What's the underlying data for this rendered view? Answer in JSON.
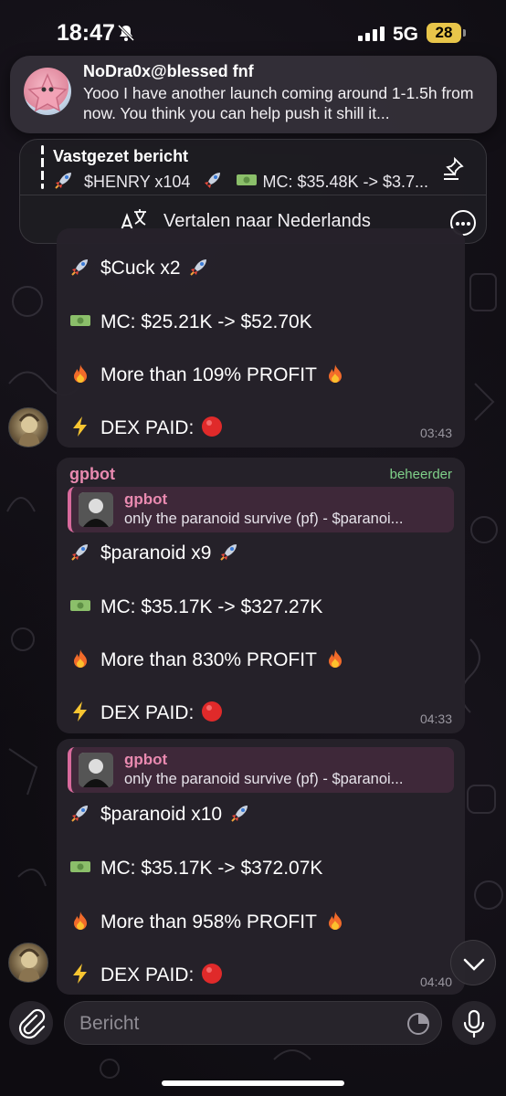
{
  "status_bar": {
    "time": "18:47",
    "network": "5G",
    "battery": "28"
  },
  "notification": {
    "sender": "NoDra0x@blessed fnf",
    "text": "Yooo I have another launch coming around 1-1.5h from now. You think you can help push it shill it..."
  },
  "pinned": {
    "title": "Vastgezet bericht",
    "text": "$HENRY x104",
    "text_mc": "MC: $35.48K -> $3.7..."
  },
  "translate_bar": {
    "label": "Vertalen naar Nederlands"
  },
  "messages": [
    {
      "ticker_line": "$Cuck x2",
      "mc_line": "MC: $25.21K -> $52.70K",
      "profit_line": "More than 109% PROFIT",
      "dex_line": "DEX PAID:",
      "time": "03:43"
    },
    {
      "sender": "gpbot",
      "role": "beheerder",
      "quote_name": "gpbot",
      "quote_text": "only the paranoid survive (pf) - $paranoi...",
      "ticker_line": "$paranoid x9",
      "mc_line": "MC: $35.17K -> $327.27K",
      "profit_line": "More than 830% PROFIT",
      "dex_line": "DEX PAID:",
      "time": "04:33"
    },
    {
      "quote_name": "gpbot",
      "quote_text": "only the paranoid survive (pf) - $paranoi...",
      "ticker_line": "$paranoid x10",
      "mc_line": "MC: $35.17K -> $372.07K",
      "profit_line": "More than 958% PROFIT",
      "dex_line": "DEX PAID:",
      "time": "04:40"
    }
  ],
  "composer": {
    "placeholder": "Bericht"
  },
  "icons": {
    "emoji": [
      "rocket-icon",
      "money-icon",
      "fire-icon",
      "lightning-icon",
      "red-circle-icon"
    ]
  },
  "colors": {
    "accent_pink": "#e98ab0",
    "admin_green": "#7fd089",
    "bubble": "#26222a"
  }
}
